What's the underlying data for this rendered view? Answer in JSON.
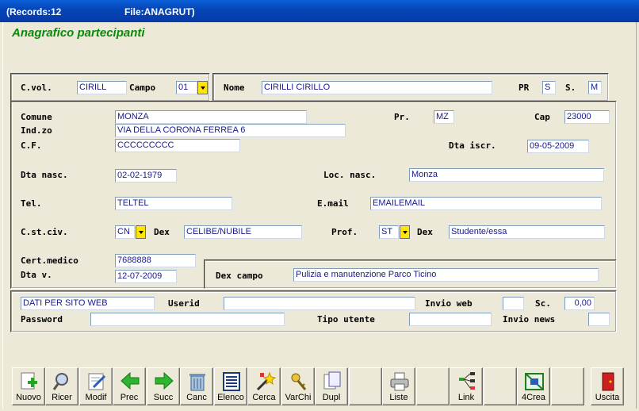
{
  "titlebar": {
    "records": "(Records:12",
    "file": "File:ANAGRUT)"
  },
  "heading": "Anagrafico partecipanti",
  "header": {
    "cvol_label": "C.vol.",
    "cvol_value": "CIRILL",
    "campo_label": "Campo",
    "campo_value": "01",
    "nome_label": "Nome",
    "nome_value": "CIRILLI CIRILLO",
    "pr_label": "PR",
    "pr_value": "S",
    "s_label": "S.",
    "s_value": "M"
  },
  "details": {
    "comune_label": "Comune",
    "comune_value": "MONZA",
    "prov_label": "Pr.",
    "prov_value": "MZ",
    "cap_label": "Cap",
    "cap_value": "23000",
    "indirizzo_label": "Ind.zo",
    "indirizzo_value": "VIA DELLA CORONA FERREA 6",
    "cf_label": "C.F.",
    "cf_value": "CCCCCCCCC",
    "dta_iscr_label": "Dta iscr.",
    "dta_iscr_value": "09-05-2009",
    "dta_nasc_label": "Dta nasc.",
    "dta_nasc_value": "02-02-1979",
    "loc_nasc_label": "Loc. nasc.",
    "loc_nasc_value": "Monza",
    "tel_label": "Tel.",
    "tel_value": "TELTEL",
    "email_label": "E.mail",
    "email_value": "EMAILEMAIL",
    "cstciv_label": "C.st.civ.",
    "cstciv_value": "CN",
    "dex1_label": "Dex",
    "dex1_value": "CELIBE/NUBILE",
    "prof_label": "Prof.",
    "prof_value": "ST",
    "dex2_label": "Dex",
    "dex2_value": "Studente/essa",
    "cert_label": "Cert.medico",
    "cert_value": "7688888",
    "dtav_label": "Dta v.",
    "dtav_value": "12-07-2009",
    "dexcampo_label": "Dex campo",
    "dexcampo_value": "Pulizia e manutenzione Parco Ticino"
  },
  "web": {
    "dati_value": "DATI PER SITO WEB",
    "userid_label": "Userid",
    "userid_value": "",
    "invio_web_label": "Invio web",
    "invio_web_value": "",
    "sc_label": "Sc.",
    "sc_value": "0,00",
    "password_label": "Password",
    "password_value": "",
    "tipo_label": "Tipo utente",
    "tipo_value": "",
    "invio_news_label": "Invio news",
    "invio_news_value": ""
  },
  "toolbar": [
    {
      "label": "Nuovo",
      "icon": "new-record-icon"
    },
    {
      "label": "Ricer",
      "icon": "magnifier-icon"
    },
    {
      "label": "Modif",
      "icon": "edit-icon"
    },
    {
      "label": "Prec",
      "icon": "arrow-left-icon"
    },
    {
      "label": "Succ",
      "icon": "arrow-right-icon"
    },
    {
      "label": "Canc",
      "icon": "trash-icon"
    },
    {
      "label": "Elenco",
      "icon": "list-icon"
    },
    {
      "label": "Cerca",
      "icon": "wand-icon"
    },
    {
      "label": "VarChi",
      "icon": "keys-icon"
    },
    {
      "label": "Dupl",
      "icon": "duplicate-icon"
    },
    {
      "label": "",
      "icon": ""
    },
    {
      "label": "Liste",
      "icon": "printer-icon"
    },
    {
      "label": "",
      "icon": ""
    },
    {
      "label": "Link",
      "icon": "link-tree-icon"
    },
    {
      "label": "",
      "icon": ""
    },
    {
      "label": "4Crea",
      "icon": "create-icon"
    },
    {
      "label": "",
      "icon": ""
    },
    {
      "label": "Uscita",
      "icon": "exit-door-icon"
    }
  ],
  "colors": {
    "heading": "#0a8a0a",
    "field_text": "#1a1a8a",
    "dropdown": "#ffe600",
    "titlebar": "#0646b8"
  }
}
